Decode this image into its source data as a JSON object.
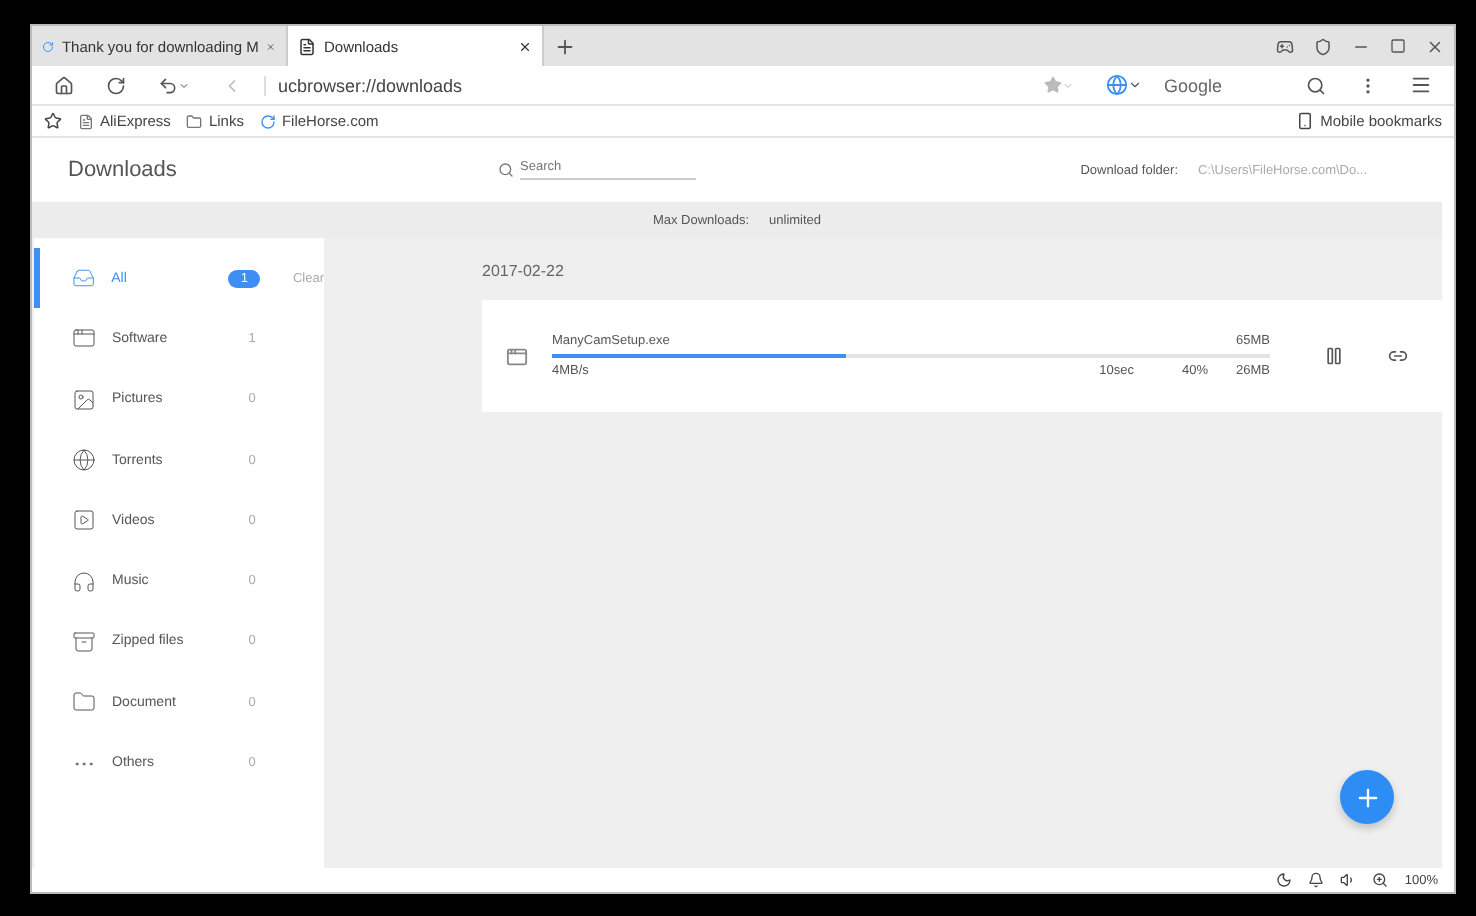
{
  "tabs": [
    {
      "label": "Thank you for downloading M",
      "selected": false
    },
    {
      "label": "Downloads",
      "selected": true
    }
  ],
  "address": "ucbrowser://downloads",
  "search_engine": "Google",
  "bookmarks": [
    {
      "label": "AliExpress",
      "kind": "page"
    },
    {
      "label": "Links",
      "kind": "folder"
    },
    {
      "label": "FileHorse.com",
      "kind": "site"
    }
  ],
  "mobile_bookmarks": "Mobile bookmarks",
  "page_title": "Downloads",
  "search": {
    "placeholder": "Search"
  },
  "download_folder": {
    "label": "Download folder:",
    "value": "C:\\Users\\FileHorse.com\\Do..."
  },
  "max_downloads": {
    "label": "Max Downloads:",
    "value": "unlimited"
  },
  "categories": [
    {
      "label": "All",
      "count": "1",
      "selected": true,
      "kind": "all"
    },
    {
      "label": "Software",
      "count": "1",
      "selected": false,
      "kind": "software"
    },
    {
      "label": "Pictures",
      "count": "0",
      "selected": false,
      "kind": "pictures"
    },
    {
      "label": "Torrents",
      "count": "0",
      "selected": false,
      "kind": "torrents"
    },
    {
      "label": "Videos",
      "count": "0",
      "selected": false,
      "kind": "videos"
    },
    {
      "label": "Music",
      "count": "0",
      "selected": false,
      "kind": "music"
    },
    {
      "label": "Zipped files",
      "count": "0",
      "selected": false,
      "kind": "zipped"
    },
    {
      "label": "Document",
      "count": "0",
      "selected": false,
      "kind": "document"
    },
    {
      "label": "Others",
      "count": "0",
      "selected": false,
      "kind": "others"
    }
  ],
  "clear": "Clear",
  "date": "2017-02-22",
  "download": {
    "name": "ManyCamSetup.exe",
    "size": "65MB",
    "level": 0.41,
    "speed": "4MB/s",
    "time": "10sec",
    "percent": "40%",
    "downloaded": "26MB"
  },
  "zoom": "100%"
}
